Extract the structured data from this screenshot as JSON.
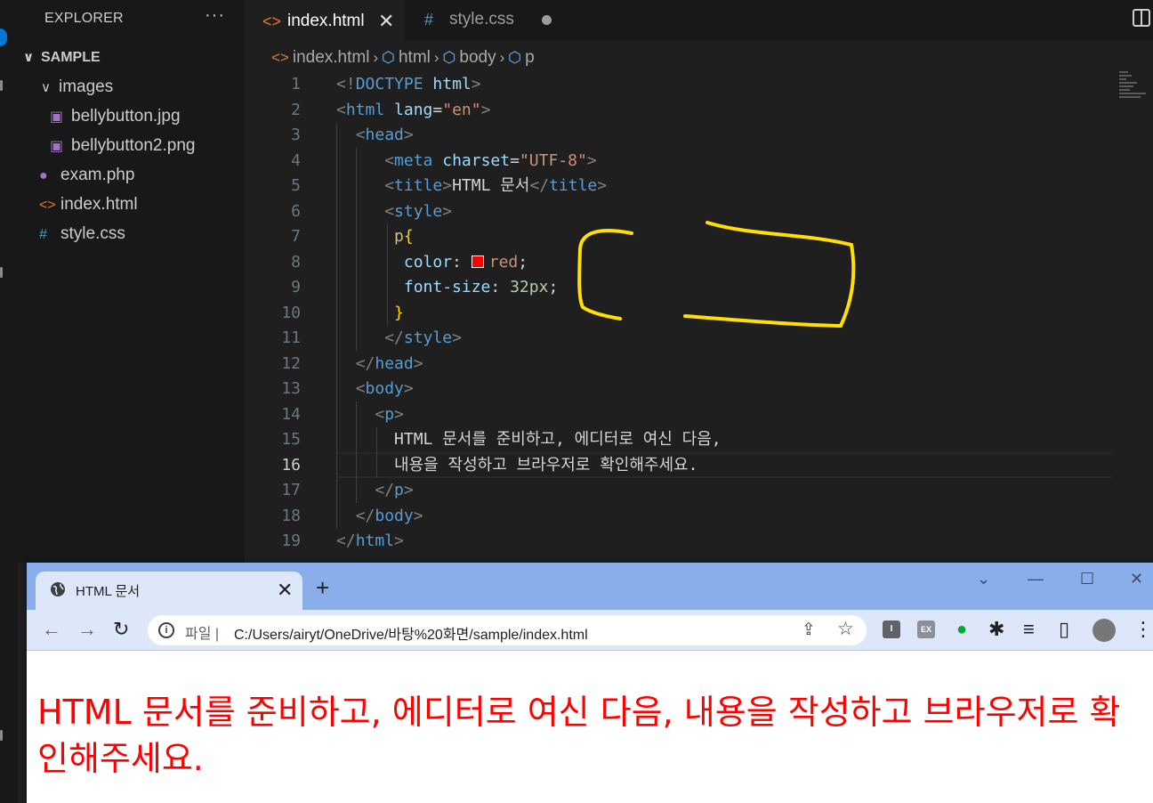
{
  "explorer": {
    "title": "EXPLORER",
    "more": "···",
    "folder": "SAMPLE",
    "subfolder": "images",
    "files_in_images": [
      "bellybutton.jpg",
      "bellybutton2.png"
    ],
    "files": [
      "exam.php",
      "index.html",
      "style.css"
    ]
  },
  "tabs": {
    "active": "index.html",
    "inactive": "style.css",
    "close": "✕"
  },
  "breadcrumb": [
    "index.html",
    "html",
    "body",
    "p"
  ],
  "code": {
    "lines": [
      [
        [
          "br",
          "<!"
        ],
        [
          "tag",
          "DOCTYPE"
        ],
        [
          "txt",
          " "
        ],
        [
          "attr",
          "html"
        ],
        [
          "br",
          ">"
        ]
      ],
      [
        [
          "br",
          "<"
        ],
        [
          "tag",
          "html"
        ],
        [
          "txt",
          " "
        ],
        [
          "attr",
          "lang"
        ],
        [
          "txt",
          "="
        ],
        [
          "str",
          "\"en\""
        ],
        [
          "br",
          ">"
        ]
      ],
      [
        [
          "txt",
          "  "
        ],
        [
          "br",
          "<"
        ],
        [
          "tag",
          "head"
        ],
        [
          "br",
          ">"
        ]
      ],
      [
        [
          "txt",
          "     "
        ],
        [
          "br",
          "<"
        ],
        [
          "tag",
          "meta"
        ],
        [
          "txt",
          " "
        ],
        [
          "attr",
          "charset"
        ],
        [
          "txt",
          "="
        ],
        [
          "str",
          "\"UTF-8\""
        ],
        [
          "br",
          ">"
        ]
      ],
      [
        [
          "txt",
          "     "
        ],
        [
          "br",
          "<"
        ],
        [
          "tag",
          "title"
        ],
        [
          "br",
          ">"
        ],
        [
          "txt",
          "HTML 문서"
        ],
        [
          "br",
          "</"
        ],
        [
          "tag",
          "title"
        ],
        [
          "br",
          ">"
        ]
      ],
      [
        [
          "txt",
          "     "
        ],
        [
          "br",
          "<"
        ],
        [
          "tag",
          "style"
        ],
        [
          "br",
          ">"
        ]
      ],
      [
        [
          "txt",
          "      "
        ],
        [
          "sel",
          "p"
        ],
        [
          "brace",
          "{"
        ]
      ],
      [
        [
          "txt",
          "       "
        ],
        [
          "attr",
          "color"
        ],
        [
          "txt",
          ": "
        ],
        [
          "swatch",
          ""
        ],
        [
          "str",
          "red"
        ],
        [
          "txt",
          ";"
        ]
      ],
      [
        [
          "txt",
          "       "
        ],
        [
          "attr",
          "font-size"
        ],
        [
          "txt",
          ": "
        ],
        [
          "num",
          "32px"
        ],
        [
          "txt",
          ";"
        ]
      ],
      [
        [
          "txt",
          "      "
        ],
        [
          "brace",
          "}"
        ]
      ],
      [
        [
          "txt",
          "     "
        ],
        [
          "br",
          "</"
        ],
        [
          "tag",
          "style"
        ],
        [
          "br",
          ">"
        ]
      ],
      [
        [
          "txt",
          "  "
        ],
        [
          "br",
          "</"
        ],
        [
          "tag",
          "head"
        ],
        [
          "br",
          ">"
        ]
      ],
      [
        [
          "txt",
          "  "
        ],
        [
          "br",
          "<"
        ],
        [
          "tag",
          "body"
        ],
        [
          "br",
          ">"
        ]
      ],
      [
        [
          "txt",
          "    "
        ],
        [
          "br",
          "<"
        ],
        [
          "tag",
          "p"
        ],
        [
          "br",
          ">"
        ]
      ],
      [
        [
          "txt",
          "      HTML 문서를 준비하고, 에디터로 여신 다음,"
        ]
      ],
      [
        [
          "txt",
          "      내용을 작성하고 브라우저로 확인해주세요."
        ]
      ],
      [
        [
          "txt",
          "    "
        ],
        [
          "br",
          "</"
        ],
        [
          "tag",
          "p"
        ],
        [
          "br",
          ">"
        ]
      ],
      [
        [
          "txt",
          "  "
        ],
        [
          "br",
          "</"
        ],
        [
          "tag",
          "body"
        ],
        [
          "br",
          ">"
        ]
      ],
      [
        [
          "br",
          "</"
        ],
        [
          "tag",
          "html"
        ],
        [
          "br",
          ">"
        ]
      ]
    ],
    "current_line": 16,
    "colors": {
      "br": "#808080",
      "tag": "#569cd6",
      "attr": "#9cdcfe",
      "str": "#ce9178",
      "sel": "#d7ba7d",
      "brace": "#ffd700",
      "num": "#b5cea8",
      "txt": "#d4d4d4"
    }
  },
  "browser": {
    "tab_title": "HTML 문서",
    "tab_close": "✕",
    "new_tab": "+",
    "win_controls": [
      "⌄",
      "—",
      "☐",
      "✕"
    ],
    "scheme": "파일 |",
    "url": "C:/Users/airyt/OneDrive/바탕%20화면/sample/index.html",
    "extensions": [
      "I",
      "EX"
    ],
    "page_text": "HTML 문서를 준비하고, 에디터로 여신 다음, 내용을 작성하고 브라우저로 확인해주세요.",
    "page_text_color": "#ff0000"
  },
  "icons": {
    "back": "←",
    "forward": "→",
    "reload": "↻",
    "share": "⇪",
    "star": "☆",
    "puzzle": "✱",
    "reading-list": "≡",
    "side-panel": "▯",
    "menu": "⋮"
  }
}
